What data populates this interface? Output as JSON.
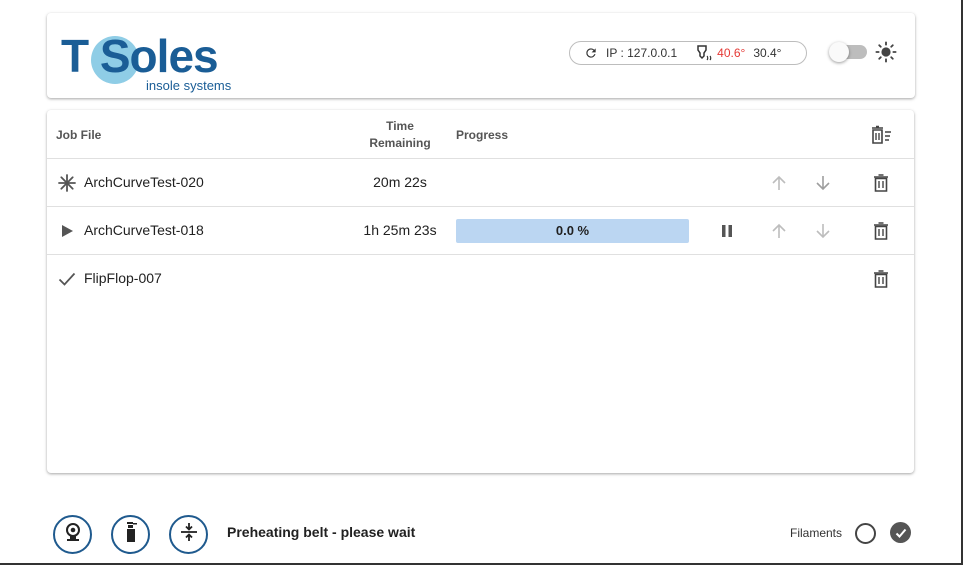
{
  "header": {
    "logo_text": "T Soles",
    "logo_tagline": "insole systems",
    "status": {
      "ip_label": "IP : 127.0.0.1",
      "hotend_temp": "40.6°",
      "bed_temp": "30.4°",
      "hotend_color": "#e53935"
    },
    "theme_toggle_on": false
  },
  "table": {
    "headers": {
      "job_file": "Job File",
      "time_line1": "Time",
      "time_line2": "Remaining",
      "progress": "Progress"
    },
    "rows": [
      {
        "status_icon": "asterisk-icon",
        "name": "ArchCurveTest-020",
        "time": "20m 22s",
        "progress": null
      },
      {
        "status_icon": "play-icon",
        "name": "ArchCurveTest-018",
        "time": "1h 25m 23s",
        "progress": "0.0 %"
      },
      {
        "status_icon": "check-icon",
        "name": "FlipFlop-007",
        "time": "",
        "progress": null
      }
    ]
  },
  "footer": {
    "message": "Preheating belt - please wait",
    "filaments_label": "Filaments",
    "buttons": [
      "webcam-icon",
      "spray-bottle-icon",
      "compress-icon"
    ]
  },
  "colors": {
    "brand": "#1a5d96",
    "logo_accent": "#8fcde6",
    "progress_fill": "#bbd6f2",
    "footer_button_border": "#1f5a8e"
  }
}
